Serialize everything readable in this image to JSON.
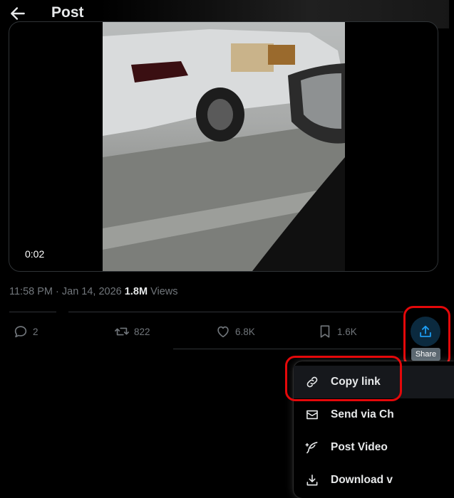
{
  "header": {
    "title": "Post",
    "back_icon": "arrow-left-icon"
  },
  "media": {
    "timestamp": "0:02"
  },
  "meta": {
    "time": "11:58 PM",
    "separator": " · ",
    "date": "Jan 14, 2026",
    "views_count": "1.8M",
    "views_label": "Views"
  },
  "actions": {
    "reply": "2",
    "repost": "822",
    "like": "6.8K",
    "bookmark": "1.6K",
    "share_tooltip": "Share"
  },
  "menu": {
    "items": [
      {
        "label": "Copy link",
        "icon": "link-icon"
      },
      {
        "label": "Send via Ch",
        "icon": "envelope-icon"
      },
      {
        "label": "Post Video",
        "icon": "quill-icon"
      },
      {
        "label": "Download v",
        "icon": "download-icon"
      }
    ]
  },
  "colors": {
    "background": "#000000",
    "text": "#e7e9ea",
    "muted": "#71767b",
    "accent": "#1d9bf0",
    "highlight": "#e4080a"
  }
}
